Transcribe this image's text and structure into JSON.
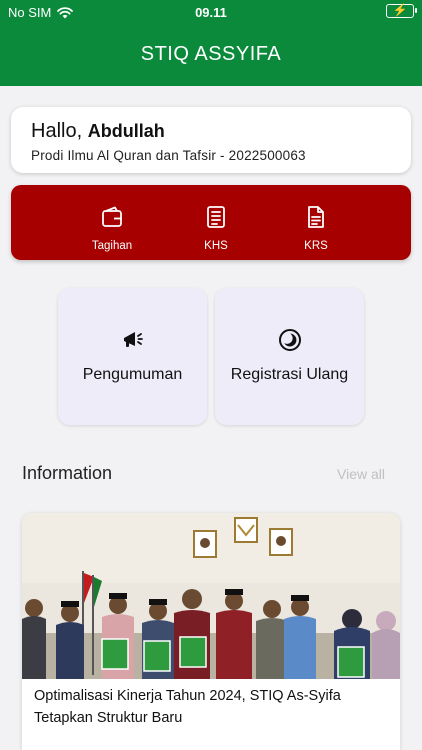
{
  "status_bar": {
    "carrier": "No SIM",
    "time": "09.11"
  },
  "app_bar": {
    "title": "STIQ ASSYIFA"
  },
  "greeting": {
    "hello": "Hallo,",
    "name": "Abdullah",
    "prodi": "Prodi Ilmu Al Quran dan Tafsir - 2022500063"
  },
  "quick_menu": [
    {
      "label": "Tagihan",
      "icon": "wallet-icon"
    },
    {
      "label": "KHS",
      "icon": "document-icon"
    },
    {
      "label": "KRS",
      "icon": "document-list-icon"
    }
  ],
  "tiles": [
    {
      "label": "Pengumuman",
      "icon": "megaphone-icon"
    },
    {
      "label": "Registrasi Ulang",
      "icon": "moon-icon"
    }
  ],
  "information": {
    "title": "Information",
    "view_all": "View all",
    "news": [
      {
        "headline": "Optimalisasi Kinerja Tahun 2024, STIQ As-Syifa Tetapkan Struktur Baru"
      }
    ]
  },
  "colors": {
    "app_bar": "#0a8a3a",
    "quick_menu": "#a60000",
    "tile": "#efecfa"
  }
}
